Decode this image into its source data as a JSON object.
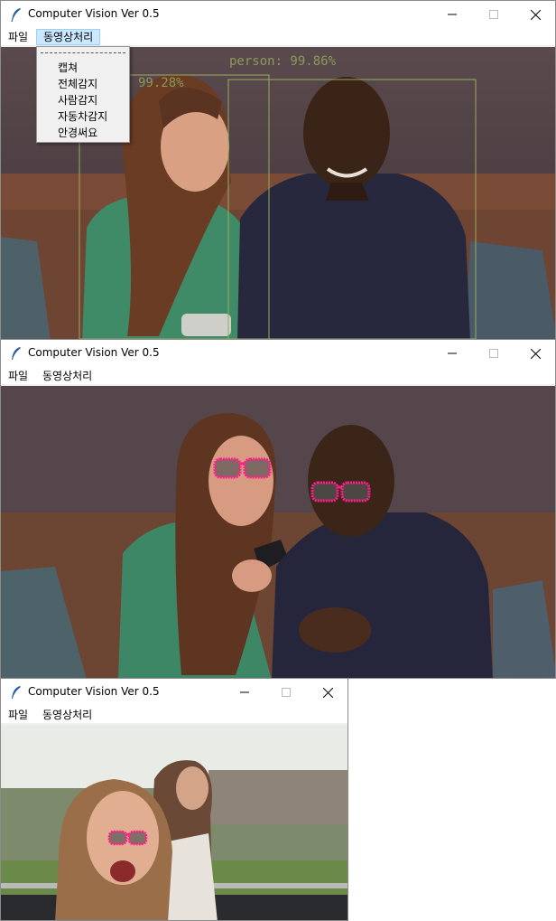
{
  "windows": [
    {
      "title": "Computer Vision Ver 0.5",
      "menu": [
        "파일",
        "동영상처리"
      ],
      "active_menu": "동영상처리",
      "dropdown_items": [
        "캡쳐",
        "전체감지",
        "사람감지",
        "자동차감지",
        "안경써요"
      ],
      "detections": [
        "person: 99.86%",
        "99.28%"
      ]
    },
    {
      "title": "Computer Vision Ver 0.5",
      "menu": [
        "파일",
        "동영상처리"
      ]
    },
    {
      "title": "Computer Vision Ver 0.5",
      "menu": [
        "파일",
        "동영상처리"
      ]
    }
  ],
  "icons": {
    "app": "feather-icon",
    "minimize": "minimize-icon",
    "maximize": "maximize-icon",
    "close": "close-icon"
  },
  "colors": {
    "detection_box": "#9aac5a",
    "sunglasses": "#ff1e8c",
    "menu_highlight": "#cce8ff"
  }
}
